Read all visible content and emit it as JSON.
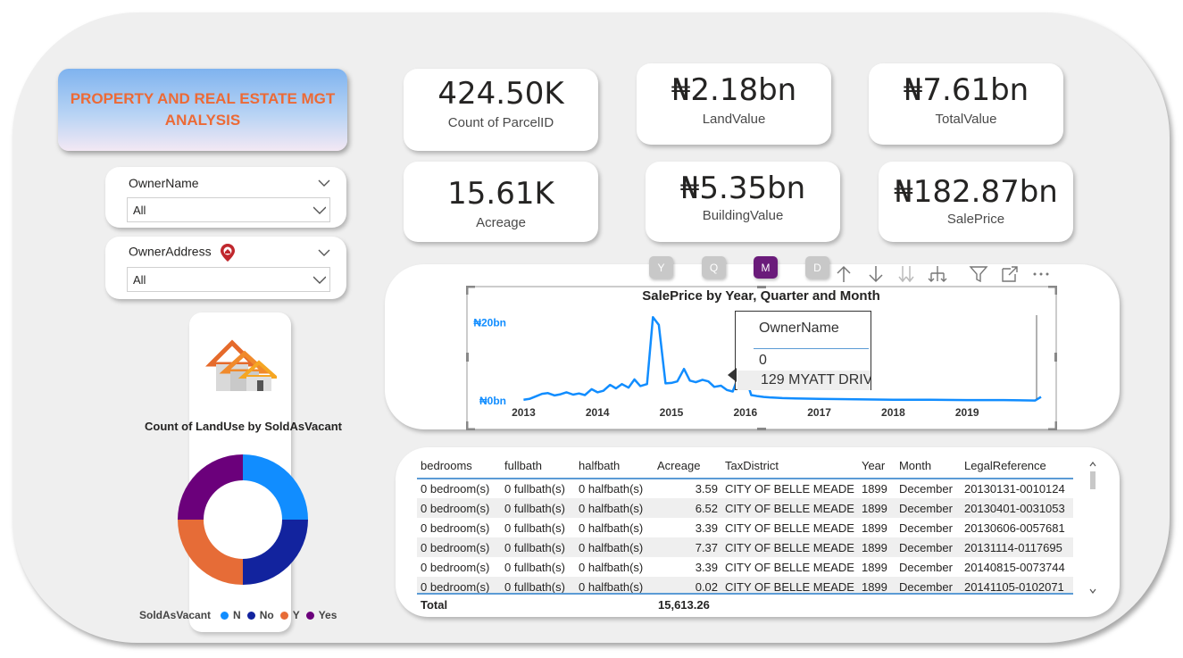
{
  "title": "PROPERTY AND REAL ESTATE MGT ANALYSIS",
  "slicers": {
    "owner_name": {
      "label": "OwnerName",
      "value": "All"
    },
    "owner_address": {
      "label": "OwnerAddress",
      "value": "All"
    }
  },
  "kpis": [
    {
      "value": "424.50K",
      "label": "Count of ParcelID"
    },
    {
      "value": "₦2.18bn",
      "label": "LandValue"
    },
    {
      "value": "₦7.61bn",
      "label": "TotalValue"
    },
    {
      "value": "15.61K",
      "label": "Acreage"
    },
    {
      "value": "₦5.35bn",
      "label": "BuildingValue"
    },
    {
      "value": "₦182.87bn",
      "label": "SalePrice"
    }
  ],
  "donut": {
    "title": "Count of LandUse by SoldAsVacant",
    "legend_title": "SoldAsVacant",
    "legend": [
      {
        "label": "N",
        "color": "#118dff"
      },
      {
        "label": "No",
        "color": "#12239e"
      },
      {
        "label": "Y",
        "color": "#e66c37"
      },
      {
        "label": "Yes",
        "color": "#6b007b"
      }
    ]
  },
  "drill_buttons": [
    "Y",
    "Q",
    "M",
    "D"
  ],
  "tooltip": {
    "header": "OwnerName",
    "row1": "0",
    "row2": "129 MYATT DRIV"
  },
  "chart_data": {
    "type": "line",
    "title": "SalePrice by Year, Quarter and Month",
    "xlabel": "",
    "ylabel": "",
    "y_ticks": [
      "₦0bn",
      "₦20bn"
    ],
    "x_ticks": [
      "2013",
      "2014",
      "2015",
      "2016",
      "2017",
      "2018",
      "2019"
    ],
    "ylim": [
      0,
      22
    ],
    "color": "#118dff",
    "series": [
      {
        "x": [
          2013.0,
          2013.08,
          2013.17,
          2013.25,
          2013.33,
          2013.42,
          2013.5,
          2013.58,
          2013.67,
          2013.75,
          2013.83,
          2013.92,
          2014.0,
          2014.08,
          2014.17,
          2014.25,
          2014.33,
          2014.42,
          2014.5,
          2014.58,
          2014.67,
          2014.75,
          2014.83,
          2014.92,
          2015.0,
          2015.08,
          2015.17,
          2015.25,
          2015.33,
          2015.42,
          2015.5,
          2015.58,
          2015.67,
          2015.75,
          2015.83,
          2015.92,
          2016.0,
          2016.08,
          2016.17,
          2016.25,
          2016.33,
          2016.42,
          2016.5,
          2016.75,
          2017.0,
          2017.5,
          2018.0,
          2018.5,
          2019.0,
          2019.5,
          2019.92,
          2020.0
        ],
        "values": [
          0.3,
          0.5,
          1.2,
          1.8,
          2.0,
          1.4,
          1.7,
          2.2,
          1.6,
          1.9,
          1.5,
          3.0,
          2.2,
          2.6,
          4.1,
          3.2,
          4.3,
          3.4,
          5.5,
          3.8,
          4.3,
          21.5,
          19.5,
          4.5,
          4.6,
          5.0,
          8.2,
          5.2,
          4.8,
          5.4,
          5.0,
          3.6,
          3.9,
          2.8,
          2.4,
          7.0,
          6.3,
          1.5,
          1.2,
          1.0,
          0.9,
          0.8,
          0.7,
          0.6,
          0.5,
          0.4,
          0.3,
          0.3,
          0.2,
          0.2,
          0.1,
          1.0
        ]
      }
    ]
  },
  "table": {
    "columns": [
      "bedrooms",
      "fullbath",
      "halfbath",
      "Acreage",
      "TaxDistrict",
      "Year",
      "Month",
      "LegalReference"
    ],
    "rows": [
      [
        "0 bedroom(s)",
        "0 fullbath(s)",
        "0 halfbath(s)",
        "3.59",
        "CITY OF BELLE MEADE",
        "1899",
        "December",
        "20130131-0010124"
      ],
      [
        "0 bedroom(s)",
        "0 fullbath(s)",
        "0 halfbath(s)",
        "6.52",
        "CITY OF BELLE MEADE",
        "1899",
        "December",
        "20130401-0031053"
      ],
      [
        "0 bedroom(s)",
        "0 fullbath(s)",
        "0 halfbath(s)",
        "3.39",
        "CITY OF BELLE MEADE",
        "1899",
        "December",
        "20130606-0057681"
      ],
      [
        "0 bedroom(s)",
        "0 fullbath(s)",
        "0 halfbath(s)",
        "7.37",
        "CITY OF BELLE MEADE",
        "1899",
        "December",
        "20131114-0117695"
      ],
      [
        "0 bedroom(s)",
        "0 fullbath(s)",
        "0 halfbath(s)",
        "3.39",
        "CITY OF BELLE MEADE",
        "1899",
        "December",
        "20140815-0073744"
      ],
      [
        "0 bedroom(s)",
        "0 fullbath(s)",
        "0 halfbath(s)",
        "0.02",
        "CITY OF BELLE MEADE",
        "1899",
        "December",
        "20141105-0102071"
      ]
    ],
    "total_label": "Total",
    "total_acreage": "15,613.26"
  }
}
